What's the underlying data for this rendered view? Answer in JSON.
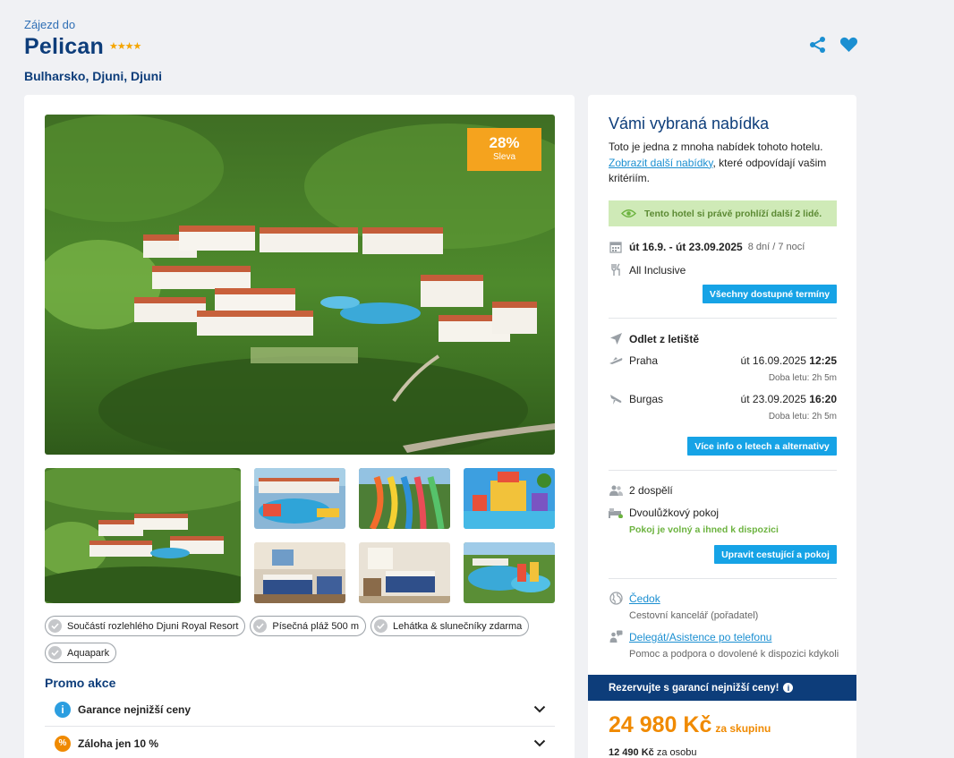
{
  "header": {
    "subtitle": "Zájezd do",
    "title": "Pelican",
    "stars": "★★★★",
    "location": "Bulharsko, Djuni, Djuni"
  },
  "hero": {
    "discount_pct": "28%",
    "discount_label": "Sleva"
  },
  "tags": [
    "Součástí rozlehlého Djuni Royal Resort",
    "Písečná pláž 500 m",
    "Lehátka & slunečníky zdarma",
    "Aquapark"
  ],
  "promo": {
    "title": "Promo akce",
    "items": [
      {
        "label": "Garance nejnižší ceny",
        "icon": "info-icon",
        "color": "#2c9ee0"
      },
      {
        "label": "Záloha jen 10 %",
        "icon": "percent-icon",
        "color": "#f08a00"
      }
    ]
  },
  "offer": {
    "title": "Vámi vybraná nabídka",
    "text_before": "Toto je jedna z mnoha nabídek tohoto hotelu.",
    "link": "Zobrazit další nabídky",
    "text_after": ", které odpovídají vašim kritériím.",
    "viewers": "Tento hotel si právě prohlíží další 2 lidé.",
    "dates": "út 16.9. - út 23.09.2025",
    "duration": "8 dní / 7 nocí",
    "board": "All Inclusive",
    "terms_button": "Všechny dostupné termíny",
    "departure_label": "Odlet z letiště",
    "flights": [
      {
        "city": "Praha",
        "date": "út 16.09.2025",
        "time": "12:25",
        "duration": "Doba letu: 2h 5m"
      },
      {
        "city": "Burgas",
        "date": "út 23.09.2025",
        "time": "16:20",
        "duration": "Doba letu: 2h 5m"
      }
    ],
    "flights_button": "Více info o letech a alternativy",
    "travellers": "2 dospělí",
    "room": "Dvoulůžkový pokoj",
    "room_status": "Pokoj je volný a ihned k dispozici",
    "edit_button": "Upravit cestující a pokoj",
    "agency_link": "Čedok",
    "agency_desc": "Cestovní kancelář (pořadatel)",
    "support_link": "Delegát/Asistence po telefonu",
    "support_desc": "Pomoc a podpora o dovolené k dispozici kdykoli"
  },
  "pricing": {
    "guarantee": "Rezervujte s garancí nejnižší ceny!",
    "total": "24 980 Kč",
    "total_suffix": "za skupinu",
    "per_person": "12 490 Kč",
    "per_person_suffix": "za osobu"
  },
  "colors": {
    "brand": "#0d3d7a",
    "accent": "#16a3e6",
    "discount": "#f5a31e",
    "price": "#f08a00"
  }
}
